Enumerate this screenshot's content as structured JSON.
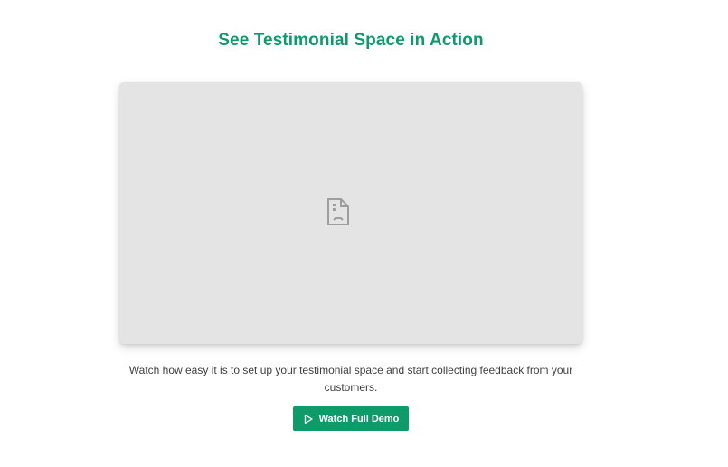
{
  "section": {
    "title": "See Testimonial Space in Action",
    "description": "Watch how easy it is to set up your testimonial space and start collecting feedback from your customers.",
    "cta_label": "Watch Full Demo"
  },
  "video": {
    "state": "failed-to-load",
    "icon": "broken-document-icon"
  },
  "icons": {
    "cta": "play-icon"
  },
  "colors": {
    "accent": "#0f9a69",
    "placeholder_bg": "#e4e4e4",
    "text": "#3f3f3f"
  }
}
